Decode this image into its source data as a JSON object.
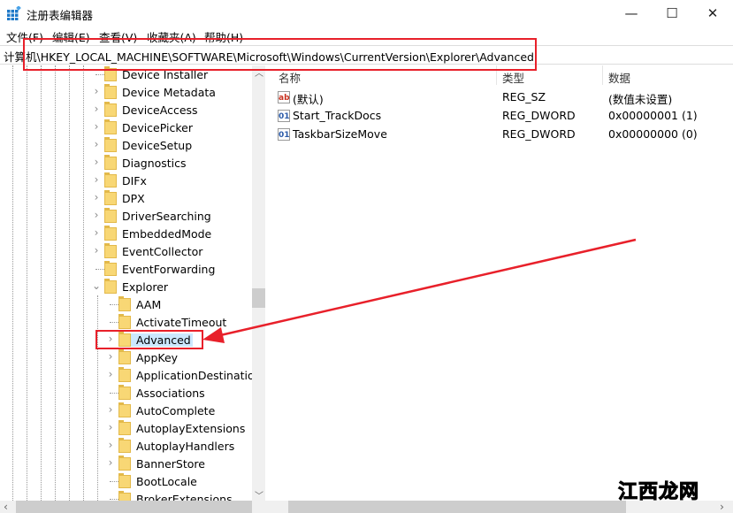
{
  "window": {
    "title": "注册表编辑器",
    "controls": {
      "minimize": "—",
      "maximize": "☐",
      "close": "✕"
    }
  },
  "menu": [
    "文件(F)",
    "编辑(E)",
    "查看(V)",
    "收藏夹(A)",
    "帮助(H)"
  ],
  "address": "计算机\\HKEY_LOCAL_MACHINE\\SOFTWARE\\Microsoft\\Windows\\CurrentVersion\\Explorer\\Advanced",
  "tree": {
    "level1": [
      {
        "label": "Device Installer",
        "expandable": false
      },
      {
        "label": "Device Metadata",
        "expandable": true
      },
      {
        "label": "DeviceAccess",
        "expandable": true
      },
      {
        "label": "DevicePicker",
        "expandable": true
      },
      {
        "label": "DeviceSetup",
        "expandable": true
      },
      {
        "label": "Diagnostics",
        "expandable": true
      },
      {
        "label": "DIFx",
        "expandable": true
      },
      {
        "label": "DPX",
        "expandable": true
      },
      {
        "label": "DriverSearching",
        "expandable": true
      },
      {
        "label": "EmbeddedMode",
        "expandable": true
      },
      {
        "label": "EventCollector",
        "expandable": true
      },
      {
        "label": "EventForwarding",
        "expandable": false
      },
      {
        "label": "Explorer",
        "expandable": true,
        "expanded": true
      }
    ],
    "explorer_children": [
      {
        "label": "AAM",
        "expandable": false
      },
      {
        "label": "ActivateTimeout",
        "expandable": false
      },
      {
        "label": "Advanced",
        "expandable": true,
        "selected": true
      },
      {
        "label": "AppKey",
        "expandable": true
      },
      {
        "label": "ApplicationDestinations",
        "expandable": true
      },
      {
        "label": "Associations",
        "expandable": false
      },
      {
        "label": "AutoComplete",
        "expandable": true
      },
      {
        "label": "AutoplayExtensions",
        "expandable": true
      },
      {
        "label": "AutoplayHandlers",
        "expandable": true
      },
      {
        "label": "BannerStore",
        "expandable": true
      },
      {
        "label": "BootLocale",
        "expandable": false
      },
      {
        "label": "BrokerExtensions",
        "expandable": false
      }
    ]
  },
  "values": {
    "headers": {
      "name": "名称",
      "type": "类型",
      "data": "数据"
    },
    "rows": [
      {
        "icon": "string-value-icon",
        "glyph": "ab",
        "name": "(默认)",
        "type": "REG_SZ",
        "data": "(数值未设置)"
      },
      {
        "icon": "dword-value-icon",
        "glyph": "01",
        "name": "Start_TrackDocs",
        "type": "REG_DWORD",
        "data": "0x00000001 (1)"
      },
      {
        "icon": "dword-value-icon",
        "glyph": "01",
        "name": "TaskbarSizeMove",
        "type": "REG_DWORD",
        "data": "0x00000000 (0)"
      }
    ]
  },
  "watermark": {
    "part1": "江西",
    "part2": "龙网"
  },
  "colors": {
    "annotation": "#e8202a",
    "selection": "#cce8ff",
    "folder": "#f8d775"
  }
}
